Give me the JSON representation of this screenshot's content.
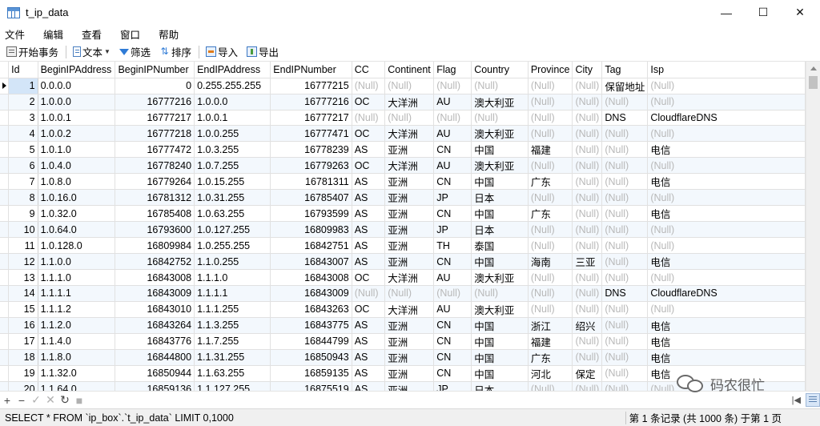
{
  "window": {
    "title": "t_ip_data",
    "minimize": "—",
    "maximize": "☐",
    "close": "✕"
  },
  "menu": [
    "文件",
    "编辑",
    "查看",
    "窗口",
    "帮助"
  ],
  "toolbar": {
    "begin_tx": "开始事务",
    "text": "文本",
    "filter": "筛选",
    "sort": "排序",
    "import": "导入",
    "export": "导出"
  },
  "table": {
    "columns": [
      "Id",
      "BeginIPAddress",
      "BeginIPNumber",
      "EndIPAddress",
      "EndIPNumber",
      "CC",
      "Continent",
      "Flag",
      "Country",
      "Province",
      "City",
      "Tag",
      "Isp"
    ],
    "rows": [
      [
        "1",
        "0.0.0.0",
        "0",
        "0.255.255.255",
        "16777215",
        "(Null)",
        "(Null)",
        "(Null)",
        "(Null)",
        "(Null)",
        "(Null)",
        "保留地址",
        "(Null)"
      ],
      [
        "2",
        "1.0.0.0",
        "16777216",
        "1.0.0.0",
        "16777216",
        "OC",
        "大洋洲",
        "AU",
        "澳大利亚",
        "(Null)",
        "(Null)",
        "(Null)",
        "(Null)"
      ],
      [
        "3",
        "1.0.0.1",
        "16777217",
        "1.0.0.1",
        "16777217",
        "(Null)",
        "(Null)",
        "(Null)",
        "(Null)",
        "(Null)",
        "(Null)",
        "DNS",
        "CloudflareDNS"
      ],
      [
        "4",
        "1.0.0.2",
        "16777218",
        "1.0.0.255",
        "16777471",
        "OC",
        "大洋洲",
        "AU",
        "澳大利亚",
        "(Null)",
        "(Null)",
        "(Null)",
        "(Null)"
      ],
      [
        "5",
        "1.0.1.0",
        "16777472",
        "1.0.3.255",
        "16778239",
        "AS",
        "亚洲",
        "CN",
        "中国",
        "福建",
        "(Null)",
        "(Null)",
        "电信"
      ],
      [
        "6",
        "1.0.4.0",
        "16778240",
        "1.0.7.255",
        "16779263",
        "OC",
        "大洋洲",
        "AU",
        "澳大利亚",
        "(Null)",
        "(Null)",
        "(Null)",
        "(Null)"
      ],
      [
        "7",
        "1.0.8.0",
        "16779264",
        "1.0.15.255",
        "16781311",
        "AS",
        "亚洲",
        "CN",
        "中国",
        "广东",
        "(Null)",
        "(Null)",
        "电信"
      ],
      [
        "8",
        "1.0.16.0",
        "16781312",
        "1.0.31.255",
        "16785407",
        "AS",
        "亚洲",
        "JP",
        "日本",
        "(Null)",
        "(Null)",
        "(Null)",
        "(Null)"
      ],
      [
        "9",
        "1.0.32.0",
        "16785408",
        "1.0.63.255",
        "16793599",
        "AS",
        "亚洲",
        "CN",
        "中国",
        "广东",
        "(Null)",
        "(Null)",
        "电信"
      ],
      [
        "10",
        "1.0.64.0",
        "16793600",
        "1.0.127.255",
        "16809983",
        "AS",
        "亚洲",
        "JP",
        "日本",
        "(Null)",
        "(Null)",
        "(Null)",
        "(Null)"
      ],
      [
        "11",
        "1.0.128.0",
        "16809984",
        "1.0.255.255",
        "16842751",
        "AS",
        "亚洲",
        "TH",
        "泰国",
        "(Null)",
        "(Null)",
        "(Null)",
        "(Null)"
      ],
      [
        "12",
        "1.1.0.0",
        "16842752",
        "1.1.0.255",
        "16843007",
        "AS",
        "亚洲",
        "CN",
        "中国",
        "海南",
        "三亚",
        "(Null)",
        "电信"
      ],
      [
        "13",
        "1.1.1.0",
        "16843008",
        "1.1.1.0",
        "16843008",
        "OC",
        "大洋洲",
        "AU",
        "澳大利亚",
        "(Null)",
        "(Null)",
        "(Null)",
        "(Null)"
      ],
      [
        "14",
        "1.1.1.1",
        "16843009",
        "1.1.1.1",
        "16843009",
        "(Null)",
        "(Null)",
        "(Null)",
        "(Null)",
        "(Null)",
        "(Null)",
        "DNS",
        "CloudflareDNS"
      ],
      [
        "15",
        "1.1.1.2",
        "16843010",
        "1.1.1.255",
        "16843263",
        "OC",
        "大洋洲",
        "AU",
        "澳大利亚",
        "(Null)",
        "(Null)",
        "(Null)",
        "(Null)"
      ],
      [
        "16",
        "1.1.2.0",
        "16843264",
        "1.1.3.255",
        "16843775",
        "AS",
        "亚洲",
        "CN",
        "中国",
        "浙江",
        "绍兴",
        "(Null)",
        "电信"
      ],
      [
        "17",
        "1.1.4.0",
        "16843776",
        "1.1.7.255",
        "16844799",
        "AS",
        "亚洲",
        "CN",
        "中国",
        "福建",
        "(Null)",
        "(Null)",
        "电信"
      ],
      [
        "18",
        "1.1.8.0",
        "16844800",
        "1.1.31.255",
        "16850943",
        "AS",
        "亚洲",
        "CN",
        "中国",
        "广东",
        "(Null)",
        "(Null)",
        "电信"
      ],
      [
        "19",
        "1.1.32.0",
        "16850944",
        "1.1.63.255",
        "16859135",
        "AS",
        "亚洲",
        "CN",
        "中国",
        "河北",
        "保定",
        "(Null)",
        "电信"
      ],
      [
        "20",
        "1.1.64.0",
        "16859136",
        "1.1.127.255",
        "16875519",
        "AS",
        "亚洲",
        "JP",
        "日本",
        "(Null)",
        "(Null)",
        "(Null)",
        "(Null)"
      ]
    ]
  },
  "navbar": {
    "add": "+",
    "delete": "−",
    "apply": "✓",
    "discard": "✕",
    "refresh": "↻",
    "stop": "■"
  },
  "status": {
    "sql": "SELECT * FROM `ip_box`.`t_ip_data` LIMIT 0,1000",
    "record": "第 1 条记录 (共 1000 条) 于第 1 页"
  },
  "watermark": "码农很忙",
  "colors": {
    "null_text": "#b8b8b8",
    "alt_row": "#f3f8fd",
    "selected_cell": "#d3e5f8"
  }
}
